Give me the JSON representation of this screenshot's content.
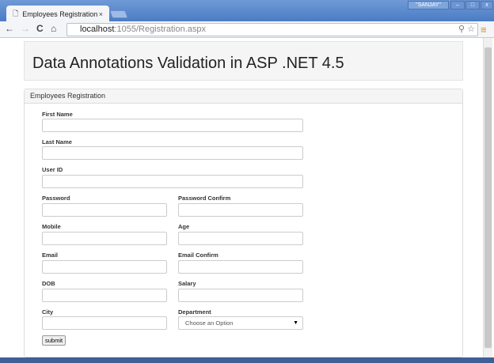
{
  "browser": {
    "tab_title": "Employees Registration",
    "tab_close": "×",
    "user": "\"SANJAY\"",
    "minimize": "–",
    "maximize": "□",
    "close": "x",
    "url_host": "localhost",
    "url_path": ":1055/Registration.aspx"
  },
  "page": {
    "title": "Data Annotations Validation in ASP .NET 4.5",
    "panel_title": "Employees Registration"
  },
  "form": {
    "first_name": "First Name",
    "last_name": "Last Name",
    "user_id": "User ID",
    "password": "Password",
    "password_confirm": "Password Confirm",
    "mobile": "Mobile",
    "age": "Age",
    "email": "Email",
    "email_confirm": "Email Confirm",
    "dob": "DOB",
    "salary": "Salary",
    "city": "City",
    "department": "Department",
    "department_selected": "Choose an Option",
    "submit": "submit"
  }
}
